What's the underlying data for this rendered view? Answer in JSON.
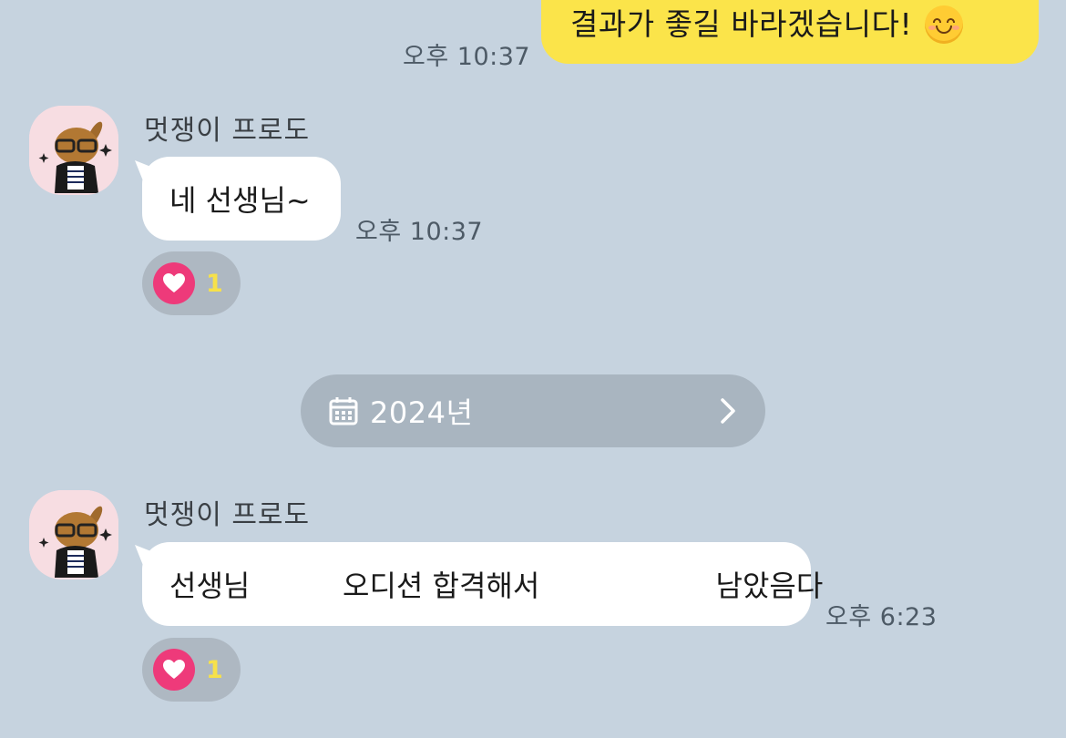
{
  "outgoing": {
    "text": "결과가 좋길 바라겠습니다!",
    "emoji_icon": "smiling-face-icon",
    "time": "오후 10:37"
  },
  "messages": [
    {
      "sender": "멋쟁이 프로도",
      "text": "네 선생님~",
      "time": "오후 10:37",
      "reaction": {
        "icon": "heart-icon",
        "count": "1"
      }
    },
    {
      "sender": "멋쟁이 프로도",
      "text": "선생님          오디션 합격해서                   남았음다",
      "time": "오후 6:23",
      "reaction": {
        "icon": "heart-icon",
        "count": "1"
      }
    }
  ],
  "date_divider": {
    "icon": "calendar-icon",
    "label": "2024년",
    "chevron": "chevron-right-icon"
  },
  "colors": {
    "background": "#c6d3df",
    "outgoing_bubble": "#fbe44a",
    "incoming_bubble": "#ffffff",
    "reaction_heart": "#ee3a7a",
    "reaction_count": "#f7e14a"
  }
}
